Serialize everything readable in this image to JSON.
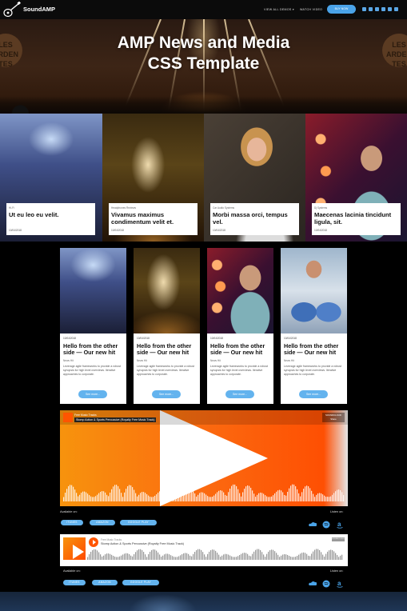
{
  "nav": {
    "logo_text": "SoundAMP",
    "links": [
      "VIEW ALL DEMOS ▾",
      "WATCH VIDEO"
    ],
    "button": "BUY NOW",
    "social_icons": [
      "facebook-icon",
      "twitter-icon",
      "pinterest-icon",
      "linkedin-icon",
      "youtube-icon",
      "instagram-icon"
    ]
  },
  "hero": {
    "title_line1": "AMP News and Media",
    "title_line2": "CSS Template",
    "sign_text": "LES ARDEN TES"
  },
  "tiles": [
    {
      "category": "Hi-Fi",
      "title": "Ut eu leo eu velit.",
      "date": "10/04/2018"
    },
    {
      "category": "Headphones Reviews",
      "title": "Vivamus maximus condimentum velit et.",
      "date": "10/04/2018"
    },
    {
      "category": "Car Audio Systems",
      "title": "Morbi massa orci, tempus vel.",
      "date": "10/04/2018"
    },
    {
      "category": "Dj Systems",
      "title": "Maecenas lacinia tincidunt ligula, sit.",
      "date": "10/04/2018"
    }
  ],
  "posts": [
    {
      "date": "10/04/2018",
      "title": "Hello from the other side — Our new hit",
      "author": "News Hit",
      "body": "Leverage agile frameworks to provide a robust synopsis for high level overviews. Iterative approaches to corporate.",
      "button": "See more..."
    },
    {
      "date": "10/04/2018",
      "title": "Hello from the other side — Our new hit",
      "author": "News Hit",
      "body": "Leverage agile frameworks to provide a robust synopsis for high level overviews. Iterative approaches to corporate.",
      "button": "See more..."
    },
    {
      "date": "10/04/2018",
      "title": "Hello from the other side — Our new hit",
      "author": "News Hit",
      "body": "Leverage agile frameworks to provide a robust synopsis for high level overviews. Iterative approaches to corporate.",
      "button": "See more..."
    },
    {
      "date": "10/04/2018",
      "title": "Hello from the other side — Our new hit",
      "author": "News Hit",
      "body": "Leverage agile frameworks to provide a robust synopsis for high level overviews. Iterative approaches to corporate.",
      "button": "See more..."
    }
  ],
  "player1": {
    "user": "Free Music Tracks",
    "track": "Stomp Action & Sports Percussive (Royalty Free Music Track)",
    "logo": "SOUNDCLOUD",
    "share": "Share"
  },
  "player2": {
    "user": "Free Music Tracks",
    "track": "Stomp Action & Sports Percussive (Royalty Free Music Track)",
    "logo": "SOUNDCLOUD"
  },
  "availability": {
    "available_on": "Available on:",
    "listen_on": "Listen on:",
    "stores": [
      "ITUNES",
      "AMAZON",
      "GOOGLE PLAY"
    ],
    "services": [
      "soundcloud-icon",
      "spotify-icon",
      "amazon-icon"
    ]
  },
  "colors": {
    "accent": "#4aa3e8",
    "button": "#63b3ee",
    "soundcloud": "#ff5500"
  }
}
